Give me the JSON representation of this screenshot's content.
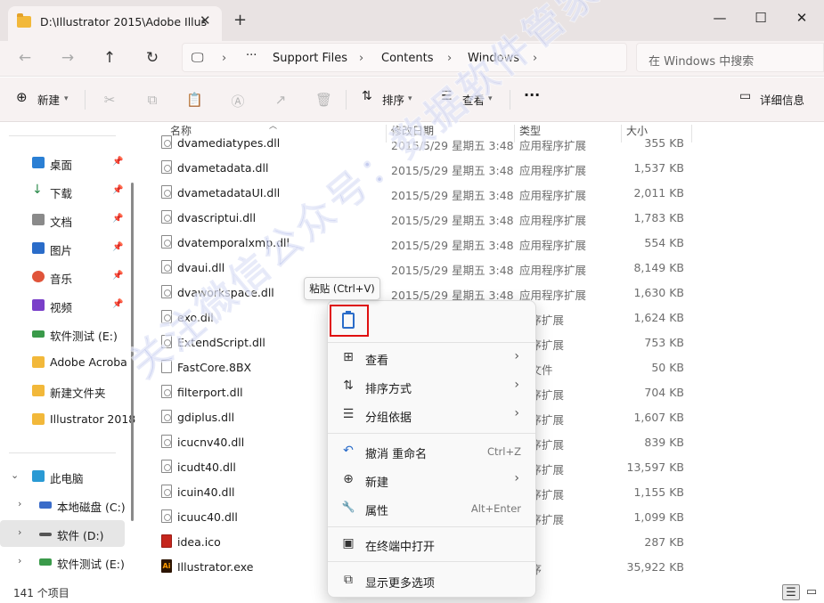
{
  "window": {
    "tab_title": "D:\\Illustrator 2015\\Adobe Illus",
    "tab_close": "✕",
    "new_tab": "+",
    "minimize": "—",
    "maximize": "☐",
    "close": "✕"
  },
  "address": {
    "back": "←",
    "forward": "→",
    "up": "↑",
    "refresh": "↻",
    "ellipsis": "···",
    "crumbs": [
      "Support Files",
      "Contents",
      "Windows"
    ],
    "search_placeholder": "在 Windows 中搜索"
  },
  "toolbar": {
    "new_label": "新建",
    "sort_label": "排序",
    "view_label": "查看",
    "more": "···",
    "details_label": "详细信息"
  },
  "sidebar": {
    "items": [
      {
        "label": "桌面",
        "color": "#2a7fd4"
      },
      {
        "label": "下载",
        "color": "#2a8a4a"
      },
      {
        "label": "文档",
        "color": "#8a8a8a"
      },
      {
        "label": "图片",
        "color": "#2a6cc9"
      },
      {
        "label": "音乐",
        "color": "#e0543a"
      },
      {
        "label": "视频",
        "color": "#7a3fc9"
      },
      {
        "label": "软件测试 (E:)",
        "color": "#3a9a4a"
      },
      {
        "label": "Adobe Acroba",
        "color": "#f2b83a"
      },
      {
        "label": "新建文件夹",
        "color": "#f2b83a"
      },
      {
        "label": "Illustrator 2018",
        "color": "#f2b83a"
      }
    ],
    "this_pc": "此电脑",
    "drives": [
      "本地磁盘 (C:)",
      "软件 (D:)",
      "软件测试 (E:)"
    ]
  },
  "columns": {
    "name": "名称",
    "date": "修改日期",
    "type": "类型",
    "size": "大小"
  },
  "files": [
    {
      "name": "dvamediatypes.dll",
      "date": "2015/5/29 星期五 3:48",
      "type": "应用程序扩展",
      "size": "355 KB"
    },
    {
      "name": "dvametadata.dll",
      "date": "2015/5/29 星期五 3:48",
      "type": "应用程序扩展",
      "size": "1,537 KB"
    },
    {
      "name": "dvametadataUI.dll",
      "date": "2015/5/29 星期五 3:48",
      "type": "应用程序扩展",
      "size": "2,011 KB"
    },
    {
      "name": "dvascriptui.dll",
      "date": "2015/5/29 星期五 3:48",
      "type": "应用程序扩展",
      "size": "1,783 KB"
    },
    {
      "name": "dvatemporalxmp.dll",
      "date": "2015/5/29 星期五 3:48",
      "type": "应用程序扩展",
      "size": "554 KB"
    },
    {
      "name": "dvaui.dll",
      "date": "2015/5/29 星期五 3:48",
      "type": "应用程序扩展",
      "size": "8,149 KB"
    },
    {
      "name": "dvaworkspace.dll",
      "date": "2015/5/29 星期五 3:48",
      "type": "应用程序扩展",
      "size": "1,630 KB"
    },
    {
      "name": "exo.dll",
      "date": "",
      "type": "程序扩展",
      "size": "1,624 KB"
    },
    {
      "name": "ExtendScript.dll",
      "date": "",
      "type": "程序扩展",
      "size": "753 KB"
    },
    {
      "name": "FastCore.8BX",
      "date": "",
      "type": "X 文件",
      "size": "50 KB"
    },
    {
      "name": "filterport.dll",
      "date": "",
      "type": "程序扩展",
      "size": "704 KB"
    },
    {
      "name": "gdiplus.dll",
      "date": "",
      "type": "程序扩展",
      "size": "1,607 KB"
    },
    {
      "name": "icucnv40.dll",
      "date": "",
      "type": "程序扩展",
      "size": "839 KB"
    },
    {
      "name": "icudt40.dll",
      "date": "",
      "type": "程序扩展",
      "size": "13,597 KB"
    },
    {
      "name": "icuin40.dll",
      "date": "",
      "type": "程序扩展",
      "size": "1,155 KB"
    },
    {
      "name": "icuuc40.dll",
      "date": "",
      "type": "程序扩展",
      "size": "1,099 KB"
    },
    {
      "name": "idea.ico",
      "date": "",
      "type": "标",
      "size": "287 KB"
    },
    {
      "name": "Illustrator.exe",
      "date": "",
      "type": "程序",
      "size": "35,922 KB"
    }
  ],
  "status": {
    "count": "141 个项目"
  },
  "tooltip": "粘贴 (Ctrl+V)",
  "context_menu": {
    "items": [
      {
        "label": "查看",
        "icon": "⊞",
        "shortcut": "",
        "arrow": "›"
      },
      {
        "label": "排序方式",
        "icon": "⇅",
        "shortcut": "",
        "arrow": "›"
      },
      {
        "label": "分组依据",
        "icon": "☰",
        "shortcut": "",
        "arrow": "›"
      },
      {
        "label": "撤消 重命名",
        "icon": "↶",
        "shortcut": "Ctrl+Z",
        "arrow": ""
      },
      {
        "label": "新建",
        "icon": "⊕",
        "shortcut": "",
        "arrow": "›"
      },
      {
        "label": "属性",
        "icon": "🔧",
        "shortcut": "Alt+Enter",
        "arrow": ""
      },
      {
        "label": "在终端中打开",
        "icon": "▣",
        "shortcut": "",
        "arrow": ""
      },
      {
        "label": "显示更多选项",
        "icon": "⧉",
        "shortcut": "",
        "arrow": ""
      }
    ]
  },
  "watermark": "关注微信公众号：数据软件管家"
}
